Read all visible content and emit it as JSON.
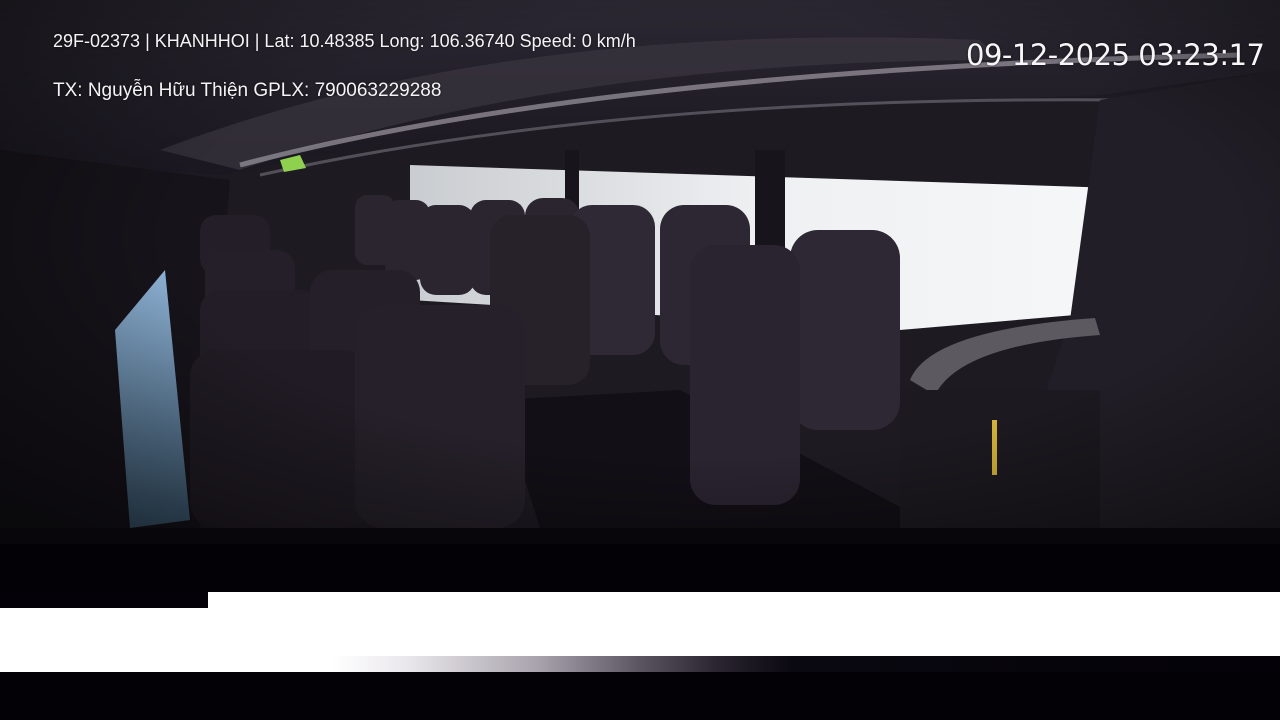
{
  "overlay": {
    "info_line": "29F-02373 | KHANHHOI | Lat: 10.48385 Long: 106.36740 Speed: 0 km/h",
    "driver_line": "TX: Nguyễn Hữu Thiện GPLX: 790063229288",
    "timestamp": "09-12-2025 03:23:17"
  },
  "scene": {
    "description_icon": "bus-interior-camera-view"
  },
  "colors": {
    "overlay_text": "#f4f4f6",
    "cabin_dark": "#1b1820",
    "window_light": "#e9ecef",
    "seat_fabric": "#2a2430"
  }
}
